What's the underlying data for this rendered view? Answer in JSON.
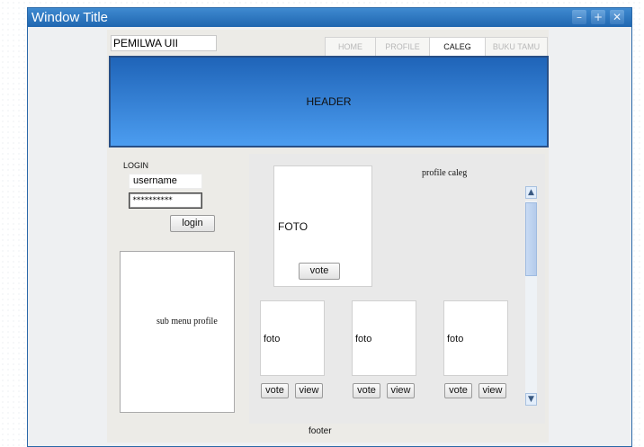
{
  "window": {
    "title": "Window Title",
    "controls": {
      "minimize": "–",
      "maximize": "+",
      "close": "✕"
    }
  },
  "site": {
    "name": "PEMILWA UII",
    "nav": {
      "tabs": [
        {
          "label": "HOME",
          "active": false
        },
        {
          "label": "PROFILE",
          "active": false
        },
        {
          "label": "CALEG",
          "active": true
        },
        {
          "label": "BUKU TAMU",
          "active": false
        }
      ]
    },
    "header": "HEADER",
    "footer": "footer"
  },
  "login": {
    "label": "LOGIN",
    "username_value": "username",
    "password_value": "**********",
    "button": "login"
  },
  "submenu": {
    "label": "sub menu profile"
  },
  "profile": {
    "title": "profile caleg",
    "main_photo_label": "FOTO",
    "vote_label": "vote"
  },
  "candidates": [
    {
      "photo_label": "foto",
      "vote_label": "vote",
      "view_label": "view"
    },
    {
      "photo_label": "foto",
      "vote_label": "vote",
      "view_label": "view"
    },
    {
      "photo_label": "foto",
      "vote_label": "vote",
      "view_label": "view"
    }
  ],
  "scrollbar": {
    "up_icon": "chevron-up-icon",
    "down_icon": "chevron-down-icon"
  }
}
